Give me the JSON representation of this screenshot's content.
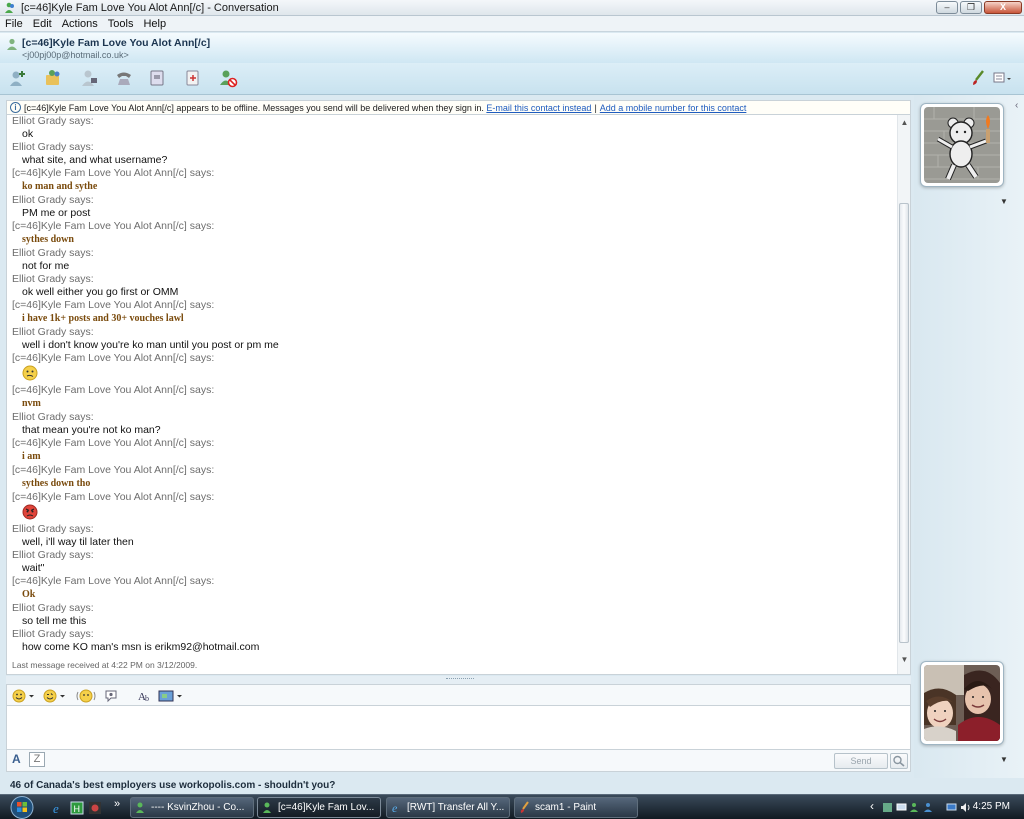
{
  "window": {
    "title": "[c=46]Kyle Fam Love You Alot Ann[/c] - Conversation",
    "buttons": {
      "minimize": "–",
      "maximize": "❐",
      "close": "X"
    }
  },
  "menu": [
    "File",
    "Edit",
    "Actions",
    "Tools",
    "Help"
  ],
  "contact": {
    "name": "[c=46]Kyle Fam Love You Alot Ann[/c]",
    "email": "<j00pj00p@hotmail.co.uk>"
  },
  "toolbar_icons": [
    "invite-icon",
    "share-files-icon",
    "video-call-icon",
    "call-icon",
    "activities-icon",
    "games-icon",
    "block-icon",
    "paint-brush-icon",
    "menu-icon"
  ],
  "infobar": {
    "message": "[c=46]Kyle Fam Love You Alot Ann[/c] appears to be offline. Messages you send will be delivered when they sign in.",
    "link1": "E-mail this contact instead",
    "sep": "|",
    "link2": "Add a mobile number for this contact"
  },
  "messages": [
    {
      "who": "Elliot Grady says:",
      "text": "ok",
      "kind": "elliot"
    },
    {
      "who": "Elliot Grady says:",
      "text": "what site, and what username?",
      "kind": "elliot"
    },
    {
      "who": "[c=46]Kyle Fam Love You Alot Ann[/c] says:",
      "text": "ko man and sythe",
      "kind": "kyle"
    },
    {
      "who": "Elliot Grady says:",
      "text": "PM me or post",
      "kind": "elliot"
    },
    {
      "who": "[c=46]Kyle Fam Love You Alot Ann[/c] says:",
      "text": "sythes down",
      "kind": "kyle"
    },
    {
      "who": "Elliot Grady says:",
      "text": "not for me",
      "kind": "elliot"
    },
    {
      "who": "Elliot Grady says:",
      "text": "ok well either you go first or OMM",
      "kind": "elliot"
    },
    {
      "who": "[c=46]Kyle Fam Love You Alot Ann[/c] says:",
      "text": "i have 1k+ posts and 30+ vouches lawl",
      "kind": "kyle"
    },
    {
      "who": "Elliot Grady says:",
      "text": "well i don't know you're ko man until you post or pm me",
      "kind": "elliot"
    },
    {
      "who": "[c=46]Kyle Fam Love You Alot Ann[/c] says:",
      "emoticon": "confused-emoticon",
      "kind": "emo"
    },
    {
      "who": "[c=46]Kyle Fam Love You Alot Ann[/c] says:",
      "text": "nvm",
      "kind": "kyle"
    },
    {
      "who": "Elliot Grady says:",
      "text": "that mean you're not ko man?",
      "kind": "elliot"
    },
    {
      "who": "[c=46]Kyle Fam Love You Alot Ann[/c] says:",
      "text": "i am",
      "kind": "kyle"
    },
    {
      "who": "[c=46]Kyle Fam Love You Alot Ann[/c] says:",
      "text": "sythes down tho",
      "kind": "kyle"
    },
    {
      "who": "[c=46]Kyle Fam Love You Alot Ann[/c] says:",
      "emoticon": "angry-emoticon",
      "kind": "emo"
    },
    {
      "who": "Elliot Grady says:",
      "text": "well, i'll way til later then",
      "kind": "elliot"
    },
    {
      "who": "Elliot Grady says:",
      "text": "wait\"",
      "kind": "elliot"
    },
    {
      "who": "[c=46]Kyle Fam Love You Alot Ann[/c] says:",
      "text": "Ok",
      "kind": "kyle"
    },
    {
      "who": "Elliot Grady says:",
      "text": "so tell me this",
      "kind": "elliot"
    },
    {
      "who": "Elliot Grady says:",
      "text": "how come KO man's msn is erikm92@hotmail.com",
      "kind": "elliot"
    }
  ],
  "last_message": "Last message received at 4:22 PM on 3/12/2009.",
  "compose": {
    "send_label": "Send",
    "font_label": "A",
    "handwriting_label": "Z"
  },
  "ad_text": "46 of Canada's best employers use workopolis.com - shouldn't you?",
  "taskbar": {
    "overflow": "»",
    "tasks": [
      {
        "label": "---- KsvinZhou - Co...",
        "active": false
      },
      {
        "label": "[c=46]Kyle Fam Lov...",
        "active": true
      },
      {
        "label": "[RWT] Transfer All Y...",
        "active": false
      },
      {
        "label": "scam1 - Paint",
        "active": false
      }
    ],
    "clock": "4:25 PM",
    "tray_arrow": "‹"
  },
  "colors": {
    "kyle_text": "#7a4b0d",
    "speaker": "#6d6d6d",
    "link": "#1f5cbf"
  }
}
